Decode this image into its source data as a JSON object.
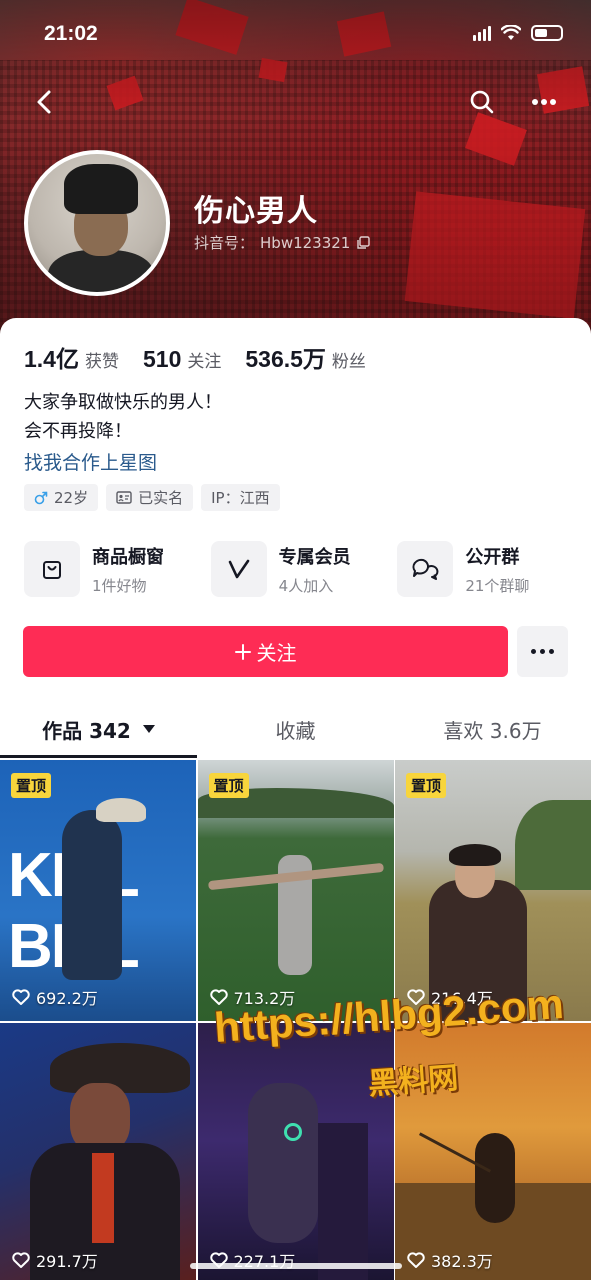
{
  "status_bar": {
    "time": "21:02"
  },
  "profile": {
    "name": "伤心男人",
    "douyin_id_label": "抖音号：",
    "douyin_id": "Hbw123321"
  },
  "stats": [
    {
      "value": "1.4亿",
      "label": "获赞"
    },
    {
      "value": "510",
      "label": "关注"
    },
    {
      "value": "536.5万",
      "label": "粉丝"
    }
  ],
  "bio": {
    "line1": "大家争取做快乐的男人！",
    "line2": "会不再投降！",
    "link": "找我合作上星图"
  },
  "tags": {
    "age": "22岁",
    "verified": "已实名",
    "ip": "IP：江西"
  },
  "features": [
    {
      "icon": "shopping-bag-icon",
      "title": "商品橱窗",
      "sub": "1件好物"
    },
    {
      "icon": "v-member-icon",
      "title": "专属会员",
      "sub": "4人加入"
    },
    {
      "icon": "chat-bubbles-icon",
      "title": "公开群",
      "sub": "21个群聊"
    }
  ],
  "actions": {
    "follow": "关注"
  },
  "tabs": [
    {
      "label": "作品 342",
      "active": true
    },
    {
      "label": "收藏",
      "active": false
    },
    {
      "label": "喜欢 3.6万",
      "active": false
    }
  ],
  "videos": [
    {
      "pinned": "置顶",
      "likes": "692.2万",
      "overlay_text": "KILL BILL"
    },
    {
      "pinned": "置顶",
      "likes": "713.2万"
    },
    {
      "pinned": "置顶",
      "likes": "216.4万"
    },
    {
      "likes": "291.7万"
    },
    {
      "likes": "227.1万"
    },
    {
      "likes": "382.3万"
    }
  ],
  "watermark": {
    "url": "https://hlbg2.com",
    "name": "黑料网"
  },
  "colors": {
    "follow_button": "#fe2c55",
    "pin_badge": "#f8d53c",
    "link": "#2a5a8c"
  }
}
